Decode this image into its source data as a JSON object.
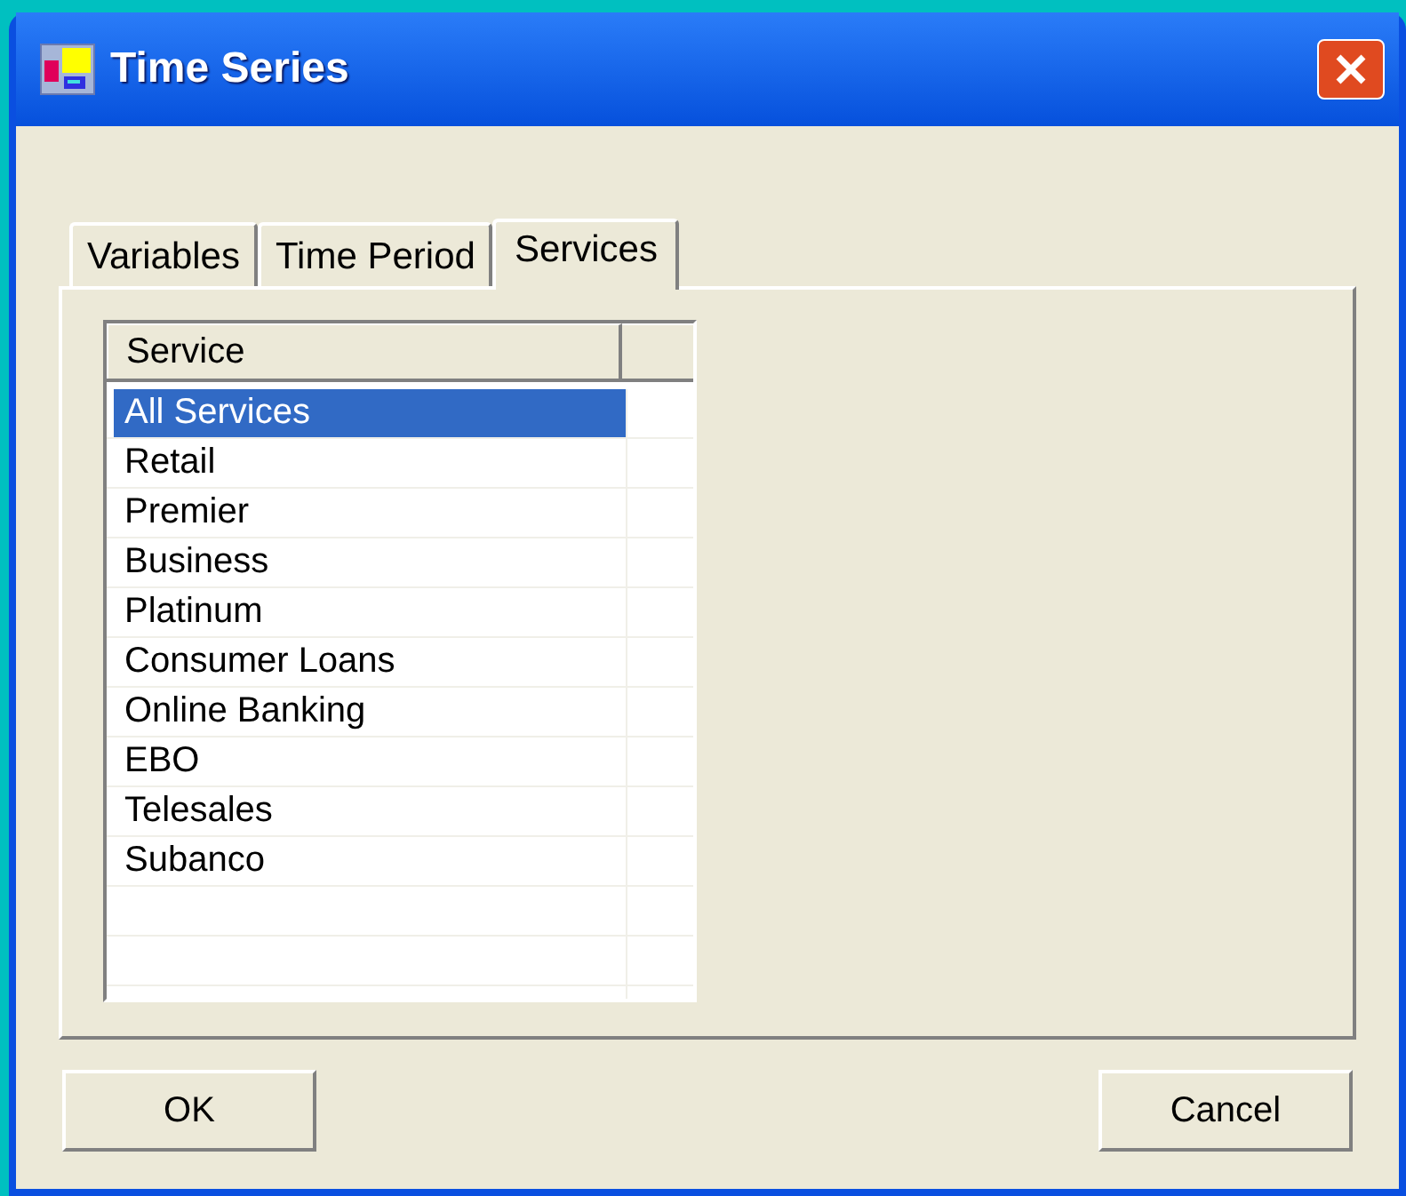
{
  "window": {
    "title": "Time Series"
  },
  "tabs": [
    {
      "label": "Variables",
      "selected": false
    },
    {
      "label": "Time Period",
      "selected": false
    },
    {
      "label": "Services",
      "selected": true
    }
  ],
  "table": {
    "columns": [
      "Service"
    ],
    "rows": [
      {
        "service": "All Services",
        "selected": true
      },
      {
        "service": "Retail",
        "selected": false
      },
      {
        "service": "Premier",
        "selected": false
      },
      {
        "service": "Business",
        "selected": false
      },
      {
        "service": "Platinum",
        "selected": false
      },
      {
        "service": "Consumer Loans",
        "selected": false
      },
      {
        "service": "Online Banking",
        "selected": false
      },
      {
        "service": "EBO",
        "selected": false
      },
      {
        "service": "Telesales",
        "selected": false
      },
      {
        "service": "Subanco",
        "selected": false
      }
    ]
  },
  "buttons": [
    "OK",
    "Cancel"
  ]
}
